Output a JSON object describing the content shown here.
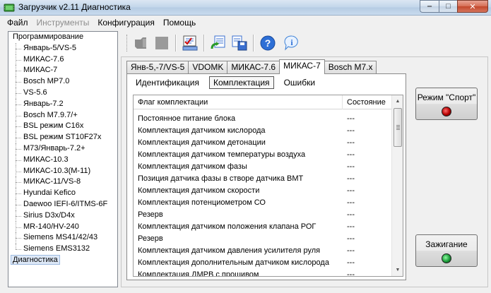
{
  "window": {
    "title": "Загрузчик v2.11 Диагностика"
  },
  "menu": [
    {
      "label": "Файл",
      "enabled": true
    },
    {
      "label": "Инструменты",
      "enabled": false
    },
    {
      "label": "Конфигурация",
      "enabled": true
    },
    {
      "label": "Помощь",
      "enabled": true
    }
  ],
  "tree": {
    "programming_label": "Программирование",
    "items": [
      "Январь-5/VS-5",
      "МИКАС-7.6",
      "МИКАС-7",
      "Bosch MP7.0",
      "VS-5.6",
      "Январь-7.2",
      "Bosch M7.9.7/+",
      "BSL режим C16x",
      "BSL режим ST10F27x",
      "M73/Январь-7.2+",
      "МИКАС-10.3",
      "МИКАС-10.3(M-11)",
      "МИКАС-11/VS-8",
      "Hyundai Kefico",
      "Daewoo IEFI-6/ITMS-6F",
      "Sirius D3x/D4x",
      "MR-140/HV-240",
      "Siemens MS41/42/43",
      "Siemens EMS3132"
    ],
    "diagnostics_label": "Диагностика"
  },
  "toolbar": {
    "icons": [
      "connect-icon",
      "stop-icon",
      "report-icon",
      "refresh-icon",
      "save-icon",
      "help-icon",
      "info-icon"
    ]
  },
  "ecu_tabs": [
    "Янв-5,-7/VS-5",
    "VDOMK",
    "МИКАС-7.6",
    "МИКАС-7",
    "Bosch M7.x"
  ],
  "ecu_tab_active": "МИКАС-7",
  "sub_tabs": [
    "Идентификация",
    "Комплектация",
    "Ошибки"
  ],
  "sub_tab_active": "Комплектация",
  "table": {
    "headers": {
      "flag": "Флаг комплектации",
      "state": "Состояние"
    },
    "rows": [
      {
        "flag": "Постоянное питание блока",
        "state": "---"
      },
      {
        "flag": "Комплектация датчиком кислорода",
        "state": "---"
      },
      {
        "flag": "Комплектация датчиком детонации",
        "state": "---"
      },
      {
        "flag": "Комплектация датчиком температуры воздуха",
        "state": "---"
      },
      {
        "flag": "Комплектация датчиком фазы",
        "state": "---"
      },
      {
        "flag": "Позиция датчика фазы в створе датчика ВМТ",
        "state": "---"
      },
      {
        "flag": "Комплектация датчиком скорости",
        "state": "---"
      },
      {
        "flag": "Комплектация потенциометром СО",
        "state": "---"
      },
      {
        "flag": "Резерв",
        "state": "---"
      },
      {
        "flag": "Комплектация датчиком положения клапана РОГ",
        "state": "---"
      },
      {
        "flag": "Резерв",
        "state": "---"
      },
      {
        "flag": "Комплектация датчиком давления усилителя руля",
        "state": "---"
      },
      {
        "flag": "Комплектация дополнительным датчиком кислорода",
        "state": "---"
      },
      {
        "flag": "Комплектация ДМРВ с прошивом",
        "state": "---"
      }
    ]
  },
  "side_buttons": {
    "sport": {
      "label": "Режим \"Спорт\"",
      "indicator": "#c00000"
    },
    "ignition": {
      "label": "Зажигание",
      "indicator": "#1c9b3a"
    }
  }
}
